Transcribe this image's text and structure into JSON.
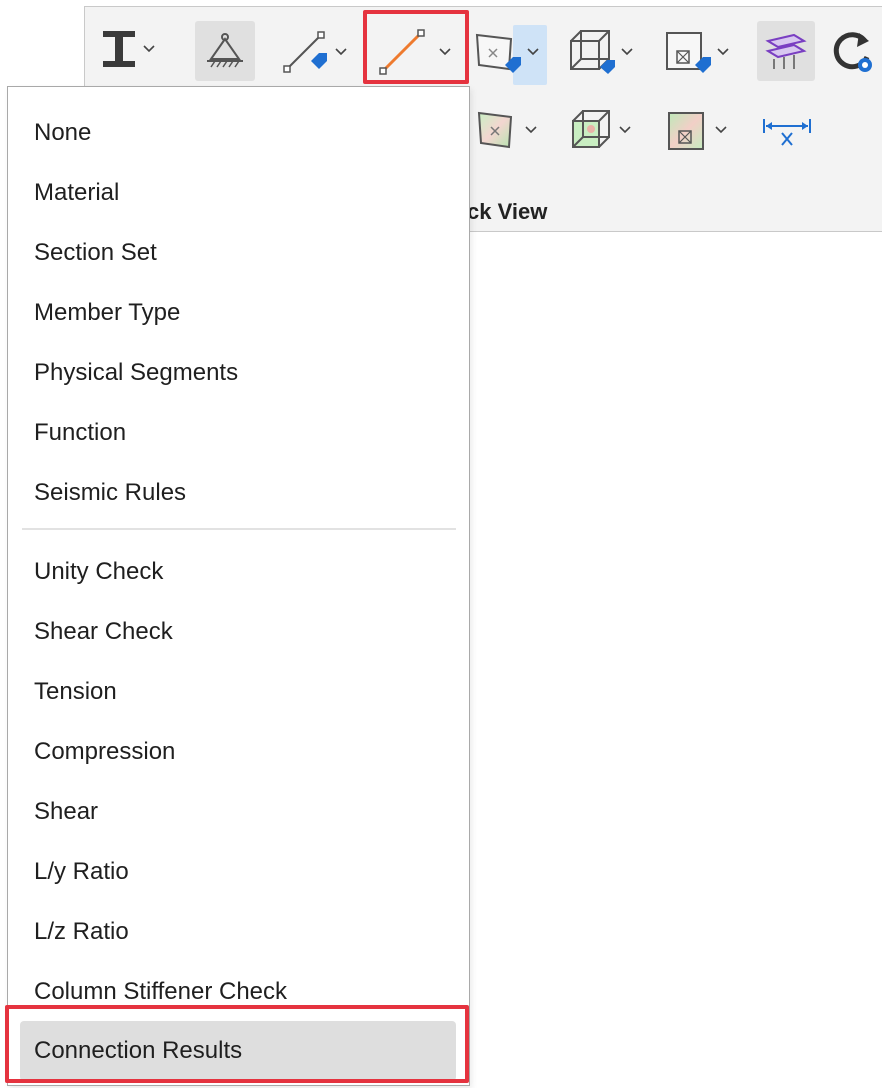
{
  "ribbon": {
    "group_label": "ck View",
    "buttons": [
      {
        "icon": "i-beam-section-icon"
      },
      {
        "icon": "support-icon"
      },
      {
        "icon": "member-tag-icon"
      },
      {
        "icon": "member-color-icon"
      },
      {
        "icon": "plate-tag-icon"
      },
      {
        "icon": "solid-tag-icon"
      },
      {
        "icon": "panel-tag-icon"
      },
      {
        "icon": "floor-layers-icon"
      },
      {
        "icon": "refresh-view-icon"
      },
      {
        "icon": "plate-contour-icon"
      },
      {
        "icon": "solid-contour-icon"
      },
      {
        "icon": "panel-contour-icon"
      },
      {
        "icon": "dimension-x-icon"
      }
    ],
    "accent_color": "#e5333f",
    "selected_split_color": "#cfe3f7"
  },
  "menu": {
    "items": [
      "None",
      "Material",
      "Section Set",
      "Member Type",
      "Physical Segments",
      "Function",
      "Seismic Rules",
      "Unity Check",
      "Shear Check",
      "Tension",
      "Compression",
      "Shear",
      "L/y Ratio",
      "L/z Ratio",
      "Column Stiffener Check",
      "Connection Results"
    ],
    "selected": "Connection Results"
  }
}
